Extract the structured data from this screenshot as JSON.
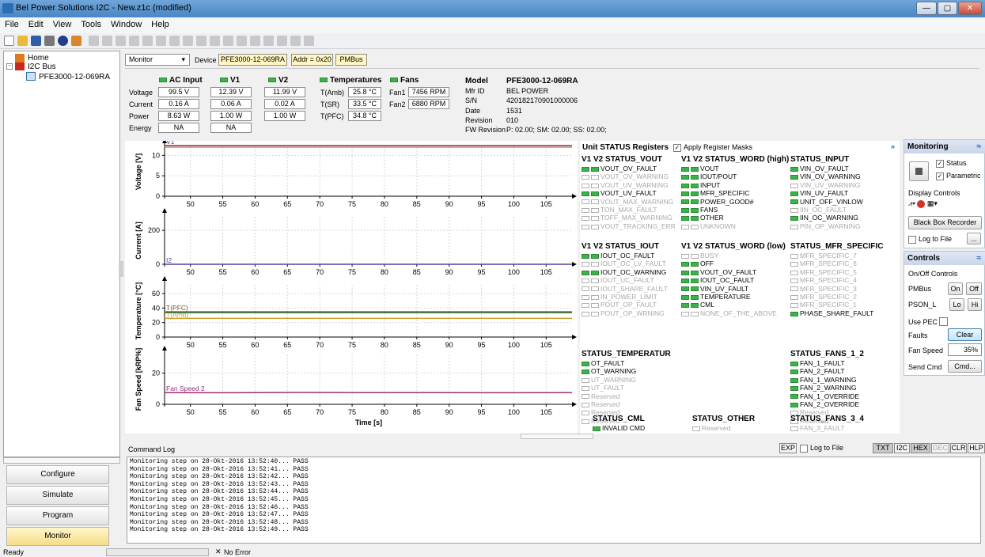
{
  "window": {
    "title": "Bel Power Solutions I2C - New.z1c (modified)",
    "controls": [
      "—",
      "▢",
      "✕"
    ]
  },
  "menu": [
    "File",
    "Edit",
    "View",
    "Tools",
    "Window",
    "Help"
  ],
  "tree": {
    "root": "Home",
    "bus": "I2C Bus",
    "device": "PFE3000-12-069RA"
  },
  "nav": [
    "Configure",
    "Simulate",
    "Program",
    "Monitor"
  ],
  "top": {
    "mode": "Monitor",
    "device_label": "Device",
    "device": "PFE3000-12-069RA",
    "addr": "Addr = 0x20",
    "protocol": "PMBus"
  },
  "readings": {
    "row_labels": [
      "Voltage",
      "Current",
      "Power",
      "Energy"
    ],
    "ac": {
      "title": "AC Input",
      "values": [
        "99.5 V",
        "0.16 A",
        "8.63 W",
        "NA"
      ]
    },
    "v1": {
      "title": "V1",
      "values": [
        "12.39 V",
        "0.06 A",
        "1.00 W",
        "NA"
      ]
    },
    "v2": {
      "title": "V2",
      "values": [
        "11.99 V",
        "0.02 A",
        "1.00 W"
      ]
    },
    "temps": {
      "title": "Temperatures",
      "labels": [
        "T(Amb)",
        "T(SR)",
        "T(PFC)"
      ],
      "values": [
        "25.8 °C",
        "33.5 °C",
        "34.8 °C"
      ]
    },
    "fans": {
      "title": "Fans",
      "labels": [
        "Fan1",
        "Fan2"
      ],
      "values": [
        "7456 RPM",
        "6880 RPM"
      ]
    }
  },
  "info": {
    "labels": [
      "Model",
      "Mfr ID",
      "S/N",
      "Date",
      "Revision",
      "FW Revision"
    ],
    "values": [
      "PFE3000-12-069RA",
      "BEL POWER",
      "420182170901000006",
      "1531",
      "010",
      "P: 02.00; SM: 02.00; SS: 02.00;"
    ]
  },
  "chart_data": [
    {
      "type": "line",
      "title": "",
      "ylabel": "Voltage [V]",
      "xlabel": "",
      "x_ticks": [
        50,
        55,
        60,
        65,
        70,
        75,
        80,
        85,
        90,
        95,
        100,
        105
      ],
      "y_ticks": [
        0,
        5,
        10
      ],
      "ylim": [
        0,
        12
      ],
      "series": [
        {
          "name": "V1",
          "color": "#5a3fa8",
          "values": [
            12.39,
            12.39
          ]
        },
        {
          "name": "",
          "color": "#e58a3a",
          "values": [
            11.99,
            11.99
          ]
        }
      ]
    },
    {
      "type": "line",
      "title": "",
      "ylabel": "Current [A]",
      "xlabel": "",
      "x_ticks": [
        50,
        55,
        60,
        65,
        70,
        75,
        80,
        85,
        90,
        95,
        100,
        105
      ],
      "y_ticks": [
        0,
        200
      ],
      "ylim": [
        0,
        280
      ],
      "series": [
        {
          "name": "I2",
          "color": "#5a3fa8",
          "values": [
            0.02,
            0.02
          ]
        }
      ]
    },
    {
      "type": "line",
      "title": "",
      "ylabel": "Temperature [°C]",
      "xlabel": "",
      "x_ticks": [
        50,
        55,
        60,
        65,
        70,
        75,
        80,
        85,
        90,
        95,
        100,
        105
      ],
      "y_ticks": [
        0,
        20,
        40,
        60
      ],
      "ylim": [
        0,
        72
      ],
      "series": [
        {
          "name": "T(PFC)",
          "color": "#8b4a2f",
          "values": [
            34.8,
            34.8
          ]
        },
        {
          "name": "T(Amb)",
          "color": "#c8a020",
          "values": [
            25.8,
            25.8
          ]
        },
        {
          "name": "",
          "color": "#3a8a3a",
          "values": [
            33.5,
            33.5
          ]
        }
      ]
    },
    {
      "type": "line",
      "title": "",
      "ylabel": "Fan Speed [kRP%]",
      "xlabel": "Time [s]",
      "x_ticks": [
        50,
        55,
        60,
        65,
        70,
        75,
        80,
        85,
        90,
        95,
        100,
        105
      ],
      "y_ticks": [
        0,
        20
      ],
      "ylim": [
        0,
        32
      ],
      "series": [
        {
          "name": "Fan Speed 2",
          "color": "#9a2f7a",
          "values": [
            7.5,
            7.4,
            7.6,
            7.5,
            7.5,
            7.4,
            7.5
          ]
        }
      ]
    }
  ],
  "status": {
    "header": "Unit STATUS Registers",
    "apply": "Apply Register Masks",
    "vout": {
      "title": "V1 V2 STATUS_VOUT",
      "items": [
        [
          "VOUT_OV_FAULT",
          true
        ],
        [
          "VOUT_OV_WARNING",
          false
        ],
        [
          "VOUT_UV_WARNING",
          false
        ],
        [
          "VOUT_UV_FAULT",
          true
        ],
        [
          "VOUT_MAX_WARNING",
          false
        ],
        [
          "TON_MAX_FAULT",
          false
        ],
        [
          "TOFF_MAX_WARNING",
          false
        ],
        [
          "VOUT_TRACKING_ERR",
          false
        ]
      ]
    },
    "word_high": {
      "title": "V1 V2 STATUS_WORD (high)",
      "items": [
        [
          "VOUT",
          true
        ],
        [
          "IOUT/POUT",
          true
        ],
        [
          "INPUT",
          true
        ],
        [
          "MFR_SPECIFIC",
          true
        ],
        [
          "POWER_GOOD#",
          true
        ],
        [
          "FANS",
          true
        ],
        [
          "OTHER",
          true
        ],
        [
          "UNKNOWN",
          false
        ]
      ]
    },
    "input": {
      "title": "STATUS_INPUT",
      "items": [
        [
          "VIN_OV_FAULT",
          true
        ],
        [
          "VIN_OV_WARNING",
          true
        ],
        [
          "VIN_UV_WARNING",
          false
        ],
        [
          "VIN_UV_FAULT",
          true
        ],
        [
          "UNIT_OFF_VINLOW",
          true
        ],
        [
          "IIN_OC_FAULT",
          false
        ],
        [
          "IIN_OC_WARNING",
          true
        ],
        [
          "PIN_OP_WARNING",
          false
        ]
      ]
    },
    "iout": {
      "title": "V1 V2 STATUS_IOUT",
      "items": [
        [
          "IOUT_OC_FAULT",
          true
        ],
        [
          "IOUT_OC_LV_FAULT",
          false
        ],
        [
          "IOUT_OC_WARNING",
          true
        ],
        [
          "IOUT_UC_FAULT",
          false
        ],
        [
          "IOUT_SHARE_FAULT",
          false
        ],
        [
          "IN_POWER_LIMIT",
          false
        ],
        [
          "POUT_OP_FAULT",
          false
        ],
        [
          "POUT_OP_WRNING",
          false
        ]
      ]
    },
    "word_low": {
      "title": "V1 V2 STATUS_WORD (low)",
      "items": [
        [
          "BUSY",
          false
        ],
        [
          "OFF",
          true
        ],
        [
          "VOUT_OV_FAULT",
          true
        ],
        [
          "IOUT_OC_FAULT",
          true
        ],
        [
          "VIN_UV_FAULT",
          true
        ],
        [
          "TEMPERATURE",
          true
        ],
        [
          "CML",
          true
        ],
        [
          "NONE_OF_THE_ABOVE",
          false
        ]
      ]
    },
    "mfr": {
      "title": "STATUS_MFR_SPECIFIC",
      "items": [
        [
          "MFR_SPECIFIC_7",
          false
        ],
        [
          "MFR_SPECIFIC_6",
          false
        ],
        [
          "MFR_SPECIFIC_5",
          false
        ],
        [
          "MFR_SPECIFIC_4",
          false
        ],
        [
          "MFR_SPECIFIC_3",
          false
        ],
        [
          "MFR_SPECIFIC_2",
          false
        ],
        [
          "MFR_SPECIFIC_1",
          false
        ],
        [
          "PHASE_SHARE_FAULT",
          true
        ]
      ]
    },
    "temp": {
      "title": "STATUS_TEMPERATUR",
      "items": [
        [
          "OT_FAULT",
          true
        ],
        [
          "OT_WARNING",
          true
        ],
        [
          "UT_WARNING",
          false
        ],
        [
          "UT_FAULT",
          false
        ],
        [
          "Reserved",
          false
        ],
        [
          "Reserved",
          false
        ],
        [
          "Reserved",
          false
        ],
        [
          "Reserved",
          false
        ]
      ]
    },
    "fans12": {
      "title": "STATUS_FANS_1_2",
      "items": [
        [
          "FAN_1_FAULT",
          true
        ],
        [
          "FAN_2_FAULT",
          true
        ],
        [
          "FAN_1_WARNING",
          true
        ],
        [
          "FAN_2_WARNING",
          true
        ],
        [
          "FAN_1_OVERRIDE",
          true
        ],
        [
          "FAN_2_OVERRIDE",
          true
        ],
        [
          "Reserved",
          false
        ],
        [
          "Reserved",
          false
        ]
      ]
    },
    "cml": {
      "title": "STATUS_CML",
      "items": [
        [
          "INVALID CMD",
          true
        ]
      ]
    },
    "other": {
      "title": "STATUS_OTHER",
      "items": [
        [
          "Reserved",
          false
        ]
      ]
    },
    "fans34": {
      "title": "STATUS_FANS_3_4",
      "items": [
        [
          "FAN_3_FAULT",
          false
        ]
      ]
    }
  },
  "monitoring": {
    "title": "Monitoring",
    "status": "Status",
    "parametric": "Parametric",
    "display_controls": "Display Controls",
    "black_box": "Black Box Recorder",
    "log_to_file": "Log to File",
    "browse": "..."
  },
  "controls": {
    "title": "Controls",
    "onoff": "On/Off Controls",
    "pmbus": "PMBus",
    "on": "On",
    "off": "Off",
    "pson": "PSON_L",
    "lo": "Lo",
    "hi": "Hi",
    "use_pec": "Use PEC",
    "faults": "Faults",
    "clear": "Clear",
    "fan_speed": "Fan Speed",
    "fan_value": "35%",
    "send_cmd": "Send Cmd",
    "cmd": "Cmd..."
  },
  "log": {
    "title": "Command Log",
    "exp": "EXP",
    "log_to_file": "Log to File",
    "buttons": [
      "TXT",
      "I2C",
      "HEX",
      "DEC",
      "CLR",
      "HLP"
    ],
    "lines": [
      "Monitoring step on 28-Okt-2016 13:52:40... PASS",
      "Monitoring step on 28-Okt-2016 13:52:41... PASS",
      "Monitoring step on 28-Okt-2016 13:52:42... PASS",
      "Monitoring step on 28-Okt-2016 13:52:43... PASS",
      "Monitoring step on 28-Okt-2016 13:52:44... PASS",
      "Monitoring step on 28-Okt-2016 13:52:45... PASS",
      "Monitoring step on 28-Okt-2016 13:52:46... PASS",
      "Monitoring step on 28-Okt-2016 13:52:47... PASS",
      "Monitoring step on 28-Okt-2016 13:52:48... PASS",
      "Monitoring step on 28-Okt-2016 13:52:49... PASS"
    ]
  },
  "statusbar": {
    "ready": "Ready",
    "error": "No Error"
  }
}
